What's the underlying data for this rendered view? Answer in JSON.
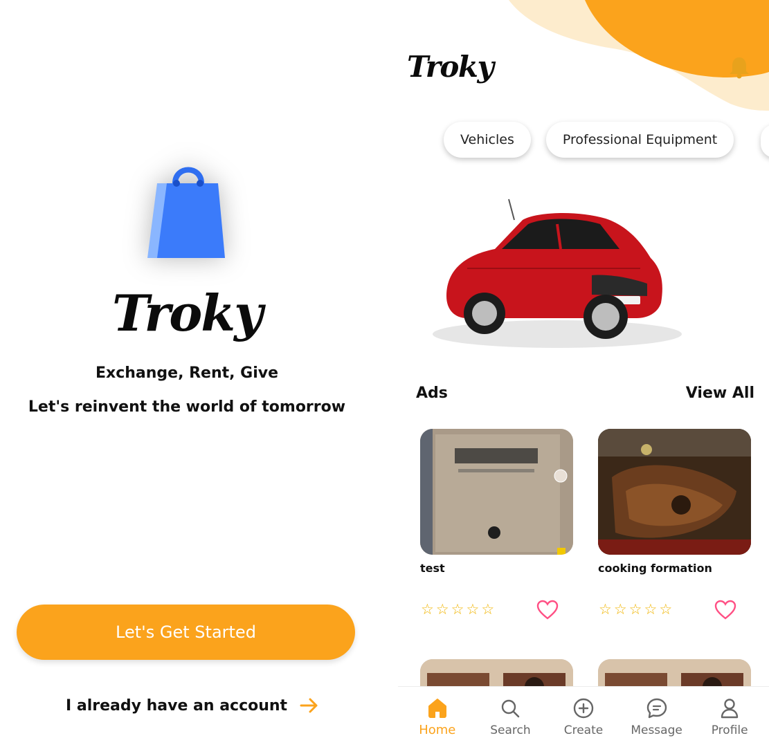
{
  "welcome": {
    "brand": "Troky",
    "tagline_1": "Exchange, Rent, Give",
    "tagline_2": "Let's reinvent the world of tomorrow",
    "start_button": "Let's Get Started",
    "account_link": "I already have an account",
    "icons": {
      "logo": "shopping-bag-icon",
      "arrow": "arrow-right-icon"
    }
  },
  "home": {
    "brand": "Troky",
    "categories": [
      "Vehicles",
      "Professional Equipment"
    ],
    "hero": {
      "image": "red-car-image"
    },
    "ads_section": {
      "title": "Ads",
      "view_all": "View All"
    },
    "ads": [
      {
        "title": "test",
        "rating": 0,
        "image": "arabic-book-cover-image"
      },
      {
        "title": "cooking formation",
        "rating": 0,
        "image": "grilled-meat-image"
      }
    ],
    "nav": [
      {
        "label": "Home",
        "icon": "home-icon",
        "active": true
      },
      {
        "label": "Search",
        "icon": "search-icon",
        "active": false
      },
      {
        "label": "Create",
        "icon": "plus-circle-icon",
        "active": false
      },
      {
        "label": "Message",
        "icon": "chat-icon",
        "active": false
      },
      {
        "label": "Profile",
        "icon": "user-icon",
        "active": false
      }
    ]
  },
  "colors": {
    "accent": "#fba31c",
    "accent_light": "#fdeccd",
    "brand_blue": "#3b7bfa",
    "heart": "#ff4f84",
    "star": "#f0b400"
  }
}
